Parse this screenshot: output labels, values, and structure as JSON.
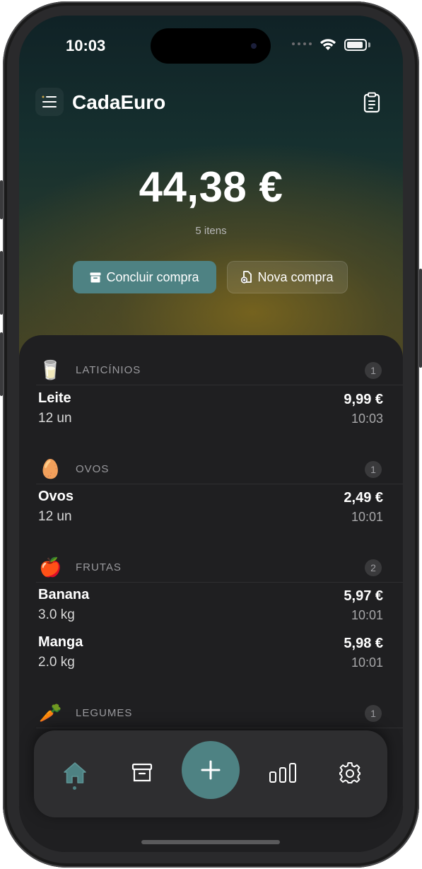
{
  "status_bar": {
    "time": "10:03"
  },
  "header": {
    "title": "CadaEuro",
    "menu_icon": "hamburger-menu-icon",
    "list_icon": "clipboard-icon"
  },
  "summary": {
    "total": "44,38 €",
    "items_count": "5 itens"
  },
  "actions": {
    "finish_label": "Concluir compra",
    "new_label": "Nova compra"
  },
  "sections": [
    {
      "emoji": "🥛",
      "label": "LATICÍNIOS",
      "count": "1",
      "items": [
        {
          "name": "Leite",
          "qty": "12 un",
          "price": "9,99 €",
          "time": "10:03"
        }
      ]
    },
    {
      "emoji": "🥚",
      "label": "OVOS",
      "count": "1",
      "items": [
        {
          "name": "Ovos",
          "qty": "12 un",
          "price": "2,49 €",
          "time": "10:01"
        }
      ]
    },
    {
      "emoji": "🍎",
      "label": "FRUTAS",
      "count": "2",
      "items": [
        {
          "name": "Banana",
          "qty": "3.0 kg",
          "price": "5,97 €",
          "time": "10:01"
        },
        {
          "name": "Manga",
          "qty": "2.0 kg",
          "price": "5,98 €",
          "time": "10:01"
        }
      ]
    },
    {
      "emoji": "🥕",
      "label": "LEGUMES",
      "count": "1",
      "items": []
    }
  ],
  "tabbar": {
    "tabs": [
      "home-icon",
      "archive-icon",
      "plus-icon",
      "chart-bars-icon",
      "gear-icon"
    ],
    "active": "home-icon"
  },
  "colors": {
    "accent": "#4e8283",
    "sheet": "#1f1f21",
    "hero_top": "#102226",
    "hero_bottom": "#4a4422"
  }
}
